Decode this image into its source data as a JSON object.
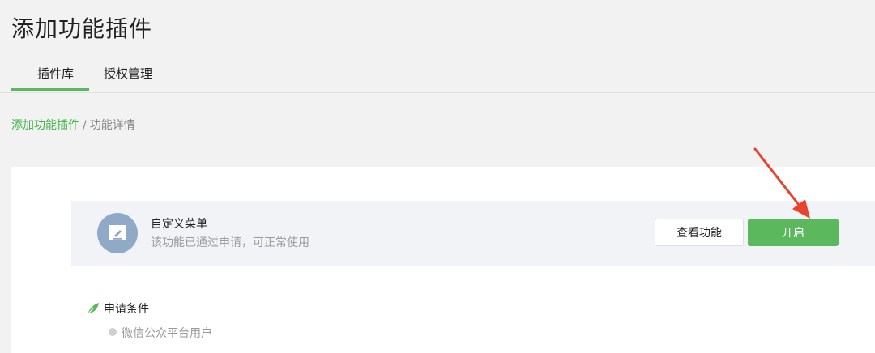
{
  "page": {
    "title": "添加功能插件"
  },
  "tabs": [
    {
      "label": "插件库",
      "active": true
    },
    {
      "label": "授权管理",
      "active": false
    }
  ],
  "breadcrumb": {
    "link": "添加功能插件",
    "separator": "/",
    "current": "功能详情"
  },
  "plugin": {
    "icon": "edit-icon",
    "name": "自定义菜单",
    "description": "该功能已通过申请，可正常使用",
    "view_label": "查看功能",
    "enable_label": "开启"
  },
  "conditions": {
    "title": "申请条件",
    "icon": "leaf-icon",
    "items": [
      "微信公众平台用户"
    ]
  },
  "colors": {
    "accent": "#5cb85c",
    "arrow": "#e8432e",
    "icon_bg": "#8fa9c6"
  }
}
